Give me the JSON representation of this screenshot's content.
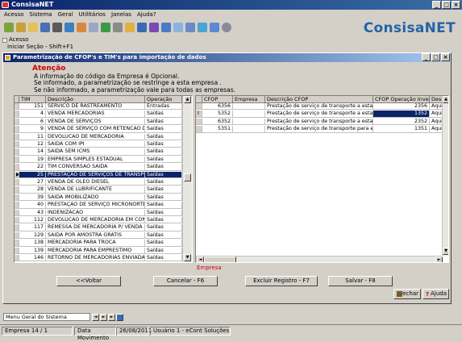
{
  "app": {
    "title": "ConsisaNET",
    "brand": "ConsisaNET",
    "menu": [
      "Acesso",
      "Sistema",
      "Geral",
      "Utilitários",
      "Janelas",
      "Ajuda?"
    ],
    "window_buttons": [
      "_",
      "□",
      "×"
    ]
  },
  "tree": {
    "root": "Acesso",
    "child": "Iniciar Seção - Shift+F1"
  },
  "dialog": {
    "title": "Parametrização de CFOP's e TIM's para importação de dados",
    "warning_title": "Atenção",
    "warning_lines": [
      "A informação do código da Empresa é Opcional.",
      "Se informado, a parametrização se restringe a esta empresa .",
      "Se não informado, a parametrização vale para todas as empresas."
    ],
    "empresa_label": "Empresa",
    "buttons": {
      "back": "<<Voltar",
      "cancel": "Cancelar - F6",
      "delete": "Excluir Registro - F7",
      "save": "Salvar - F8",
      "close": "Fechar",
      "help": "Ajuda"
    }
  },
  "left_table": {
    "headers": [
      "TIM",
      "Descrição",
      "Operação"
    ],
    "rows": [
      {
        "tim": "151",
        "desc": "SERVICO DE RASTREAMENTO",
        "op": "Entradas"
      },
      {
        "tim": "4",
        "desc": "VENDA MERCADORIAS",
        "op": "Saídas"
      },
      {
        "tim": "6",
        "desc": "VENDA DE SERVIÇOS",
        "op": "Saídas"
      },
      {
        "tim": "9",
        "desc": "VENDA DE SERVIÇO COM RETENCAO DE IR",
        "op": "Saídas"
      },
      {
        "tim": "11",
        "desc": "DEVOLUCAO DE MERCADORIA",
        "op": "Saídas"
      },
      {
        "tim": "12",
        "desc": "SAIDA COM IPI",
        "op": "Saídas"
      },
      {
        "tim": "14",
        "desc": "SAIDA SEM ICMS",
        "op": "Saídas"
      },
      {
        "tim": "19",
        "desc": "EMPRESA SIMPLES ESTADUAL",
        "op": "Saídas"
      },
      {
        "tim": "22",
        "desc": "TIM CONVERSAO SAIDA",
        "op": "Saídas"
      },
      {
        "tim": "25",
        "desc": "PRESTAÇÃO DE SERVIÇOS DE TRANSPOR",
        "op": "Saídas",
        "selected": true
      },
      {
        "tim": "27",
        "desc": "VENDA DE OLEO DIESEL",
        "op": "Saídas"
      },
      {
        "tim": "28",
        "desc": "VENDA DE LUBRIFICANTE",
        "op": "Saídas"
      },
      {
        "tim": "39",
        "desc": "SAIDA IMOBILIZADO",
        "op": "Saídas"
      },
      {
        "tim": "40",
        "desc": "PRESTAÇÃO DE SERVIÇO MICRONORTE",
        "op": "Saídas"
      },
      {
        "tim": "43",
        "desc": "INDENIZACAO",
        "op": "Saídas"
      },
      {
        "tim": "112",
        "desc": "DEVOLUCAO DE MERCADORIA EM CONSIG",
        "op": "Saídas"
      },
      {
        "tim": "117",
        "desc": "REMESSA DE MERCADORIA P/ VENDA FOR",
        "op": "Saídas"
      },
      {
        "tim": "129",
        "desc": "SAIDA POR AMOSTRA GRÁTIS",
        "op": "Saídas"
      },
      {
        "tim": "138",
        "desc": "MERCADORIA PARA TROCA",
        "op": "Saídas"
      },
      {
        "tim": "139",
        "desc": "MERCADORIA PARA EMPRÉSTIMO",
        "op": "Saídas"
      },
      {
        "tim": "146",
        "desc": "RETORNO DE MERCADORIAS ENVIADAS P",
        "op": "Saídas"
      }
    ]
  },
  "right_table": {
    "headers": [
      "CFOP",
      "Empresa",
      "Descrição CFOP",
      "CFOP Operação Inversa",
      "Descr"
    ],
    "rows": [
      {
        "cfop": "6356",
        "empresa": "",
        "desc": "Prestação de serviço de transporte a estabelecim",
        "inv": "2356",
        "descr": "Aquisiç"
      },
      {
        "cfop": "5352",
        "empresa": "",
        "desc": "Prestação de serviço de transporte a estabelecim",
        "inv": "1352",
        "descr": "Aquisiç",
        "active": true
      },
      {
        "cfop": "6352",
        "empresa": "",
        "desc": "Prestação de serviço de transporte a estabelecim",
        "inv": "2352",
        "descr": "Aquisiç"
      },
      {
        "cfop": "5351",
        "empresa": "",
        "desc": "Prestação de serviço de transporte para execução",
        "inv": "1351",
        "descr": "Aquisiç"
      }
    ]
  },
  "bottom": {
    "menu_field": "Menu Geral do Sistema"
  },
  "status": {
    "empresa": "Empresa 14 / 1",
    "data_mov_label": "Data Movimento",
    "data_mov": "26/08/2011",
    "usuario": "Usuário  1 - eCont Soluções"
  },
  "colors": {
    "title_bar": "#0a246a",
    "brand": "#2563a8",
    "warning": "#cc0000",
    "selection": "#0a246a"
  }
}
